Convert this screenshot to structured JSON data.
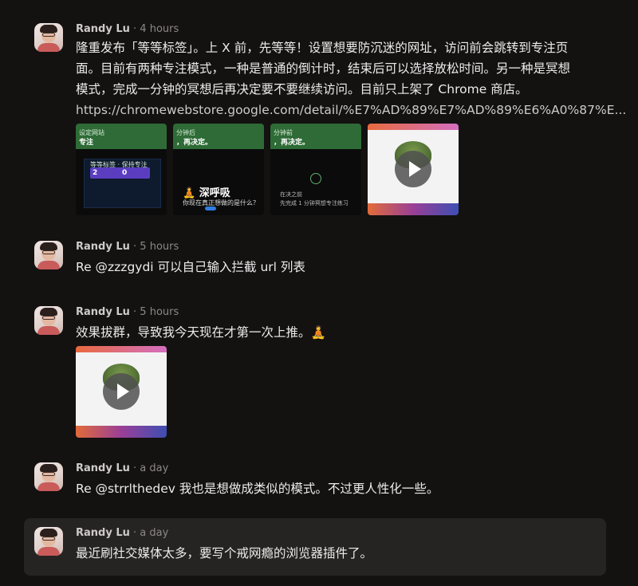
{
  "posts": [
    {
      "author": "Randy Lu",
      "time": "· 4 hours",
      "lines": [
        "隆重发布「等等标签」。上 X 前，先等等！设置想要防沉迷的网址，访问前会跳转到专注页",
        "面。目前有两种专注模式，一种是普通的倒计时，结束后可以选择放松时间。另一种是冥想",
        "模式，完成一分钟的冥想后再决定要不要继续访问。目前只上架了 Chrome 商店。"
      ],
      "link": "https://chromewebstore.google.com/detail/%E7%AD%89%E7%AD%89%E6%A0%87%E...",
      "thumbs": [
        {
          "top": "设定网站",
          "title": "专注",
          "panel": "等等标签 · 保持专注",
          "stat1": "2",
          "stat2": "0"
        },
        {
          "top": "分钟后",
          "title": "，再决定。",
          "big": "🧘 深呼吸",
          "sub": "你现在真正想做的是什么？"
        },
        {
          "top": "分钟前",
          "title": "，再决定。",
          "mini1": "在决之前",
          "mini2": "先完成 1 分钟冥想专注练习"
        },
        {
          "type": "video"
        }
      ]
    },
    {
      "author": "Randy Lu",
      "time": "· 5 hours",
      "lines": [
        "Re @zzzgydi 可以自己输入拦截 url 列表"
      ]
    },
    {
      "author": "Randy Lu",
      "time": "· 5 hours",
      "lines": [
        "效果拔群，导致我今天现在才第一次上推。🧘"
      ],
      "thumbs": [
        {
          "type": "video"
        }
      ]
    },
    {
      "author": "Randy Lu",
      "time": "· a day",
      "lines": [
        "Re @strrlthedev 我也是想做成类似的模式。不过更人性化一些。"
      ]
    },
    {
      "author": "Randy Lu",
      "time": "· a day",
      "lines": [
        "最近刷社交媒体太多，要写个戒网瘾的浏览器插件了。"
      ]
    }
  ],
  "icons": {
    "play": "play-icon",
    "avatar": "avatar"
  },
  "colors": {
    "background": "#141111",
    "highlight": "#262323",
    "bar": "#2e6b36"
  }
}
